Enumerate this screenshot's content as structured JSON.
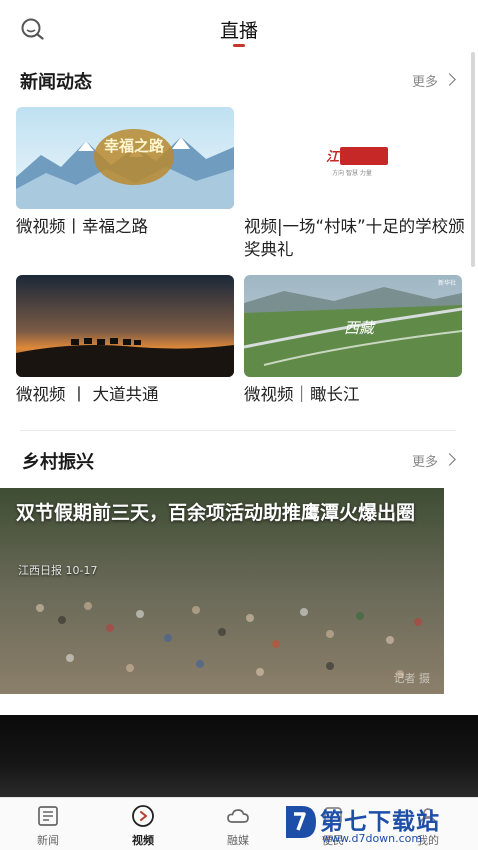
{
  "header": {
    "title": "直播"
  },
  "sections": [
    {
      "title": "新闻动态",
      "more": "更多",
      "cards": [
        {
          "caption": "微视频丨幸福之路",
          "thumb_text": "幸福之路"
        },
        {
          "caption": "视频|一场“村味”十足的学校颁奖典礼",
          "thumb_text": "江西视频",
          "thumb_sub": "方向 智慧 力量"
        },
        {
          "caption": "微视频 丨 大道共通"
        },
        {
          "caption": "微视频｜瞰长江",
          "thumb_text": "西藏",
          "thumb_corner": "新华社"
        }
      ]
    },
    {
      "title": "乡村振兴",
      "more": "更多",
      "hero": {
        "headline": "双节假期前三天，百余项活动助推鹰潭火爆出圈",
        "meta": "江西日报 10-17",
        "watermark": "记者 摄"
      }
    }
  ],
  "tabbar": [
    {
      "label": "新闻",
      "icon": "news-icon",
      "active": false
    },
    {
      "label": "视频",
      "icon": "video-play-icon",
      "active": true
    },
    {
      "label": "融媒",
      "icon": "cloud-icon",
      "active": false
    },
    {
      "label": "便民",
      "icon": "service-icon",
      "active": false
    },
    {
      "label": "我的",
      "icon": "profile-icon",
      "active": false
    }
  ],
  "watermark_brand": {
    "name": "第七下载站",
    "url": "www.d7down.com"
  },
  "colors": {
    "accent": "#c0392b",
    "brand_blue": "#1e4fa8"
  }
}
